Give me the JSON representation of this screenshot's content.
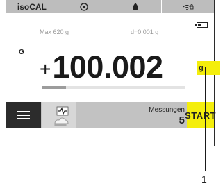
{
  "statusbar": {
    "title": "isoCAL",
    "icons": [
      "level-target-icon",
      "drop-icon",
      "wifi-lock-icon"
    ]
  },
  "weighing": {
    "max_capacity": "Max 620 g",
    "readability": "d=0.001 g",
    "mode_label": "G",
    "sign": "+",
    "value": "100.002",
    "unit": "g",
    "progress_fraction": 0.17
  },
  "actionbar": {
    "measurements_label": "Messungen",
    "measurements_count": "5",
    "start_label": "START"
  },
  "callout": {
    "number": "1"
  },
  "colors": {
    "accent_yellow": "#f4ee0c",
    "statusbar_gray": "#bdbdbd",
    "actionbar_gray": "#c2c2c2",
    "menu_dark": "#2c2c2c"
  }
}
